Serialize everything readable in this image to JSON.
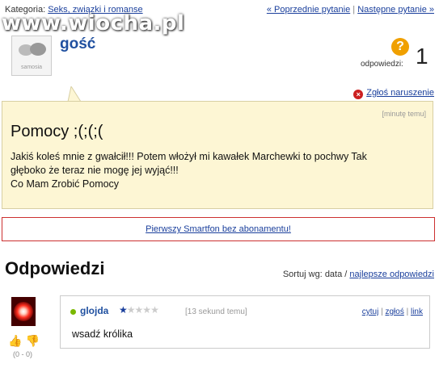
{
  "topbar": {
    "category_label": "Kategoria:",
    "category_value": "Seks, związki i romanse",
    "prev": "« Poprzednie pytanie",
    "sep": "|",
    "next": "Następne pytanie »"
  },
  "watermark": "www.wiocha.pl",
  "question": {
    "avatar_label": "samosia",
    "author": "gość",
    "answers_label": "odpowiedzi:",
    "answers_count": "1",
    "report": "Zgłoś naruszenie",
    "time": "[minutę temu]",
    "title": "Pomocy ;(;(;(",
    "body_line1": "Jakiś koleś mnie z gwałcił!!! Potem włożył mi kawałek Marchewki to pochwy Tak",
    "body_line2": "głęboko że teraz nie mogę jej wyjąć!!!",
    "body_line3": "Co Mam Zrobić Pomocy"
  },
  "ad": {
    "text": "Pierwszy Smartfon bez abonamentu!"
  },
  "answers": {
    "heading": "Odpowiedzi",
    "sort_label": "Sortuj wg:",
    "sort_date": "data",
    "sort_sep": "/",
    "sort_best": "najlepsze odpowiedzi",
    "items": [
      {
        "author": "glojda",
        "rating_stars": 5,
        "rating_value": 1,
        "time": "[13 sekund temu]",
        "quote": "cytuj",
        "report": "zgłoś",
        "link": "link",
        "body": "wsadź królika",
        "votes": "(0 - 0)"
      }
    ]
  },
  "colors": {
    "question_bg": "#fdf6d4",
    "link": "#1a3f9c",
    "author": "#2050a0",
    "ad_border": "#cc3030"
  }
}
